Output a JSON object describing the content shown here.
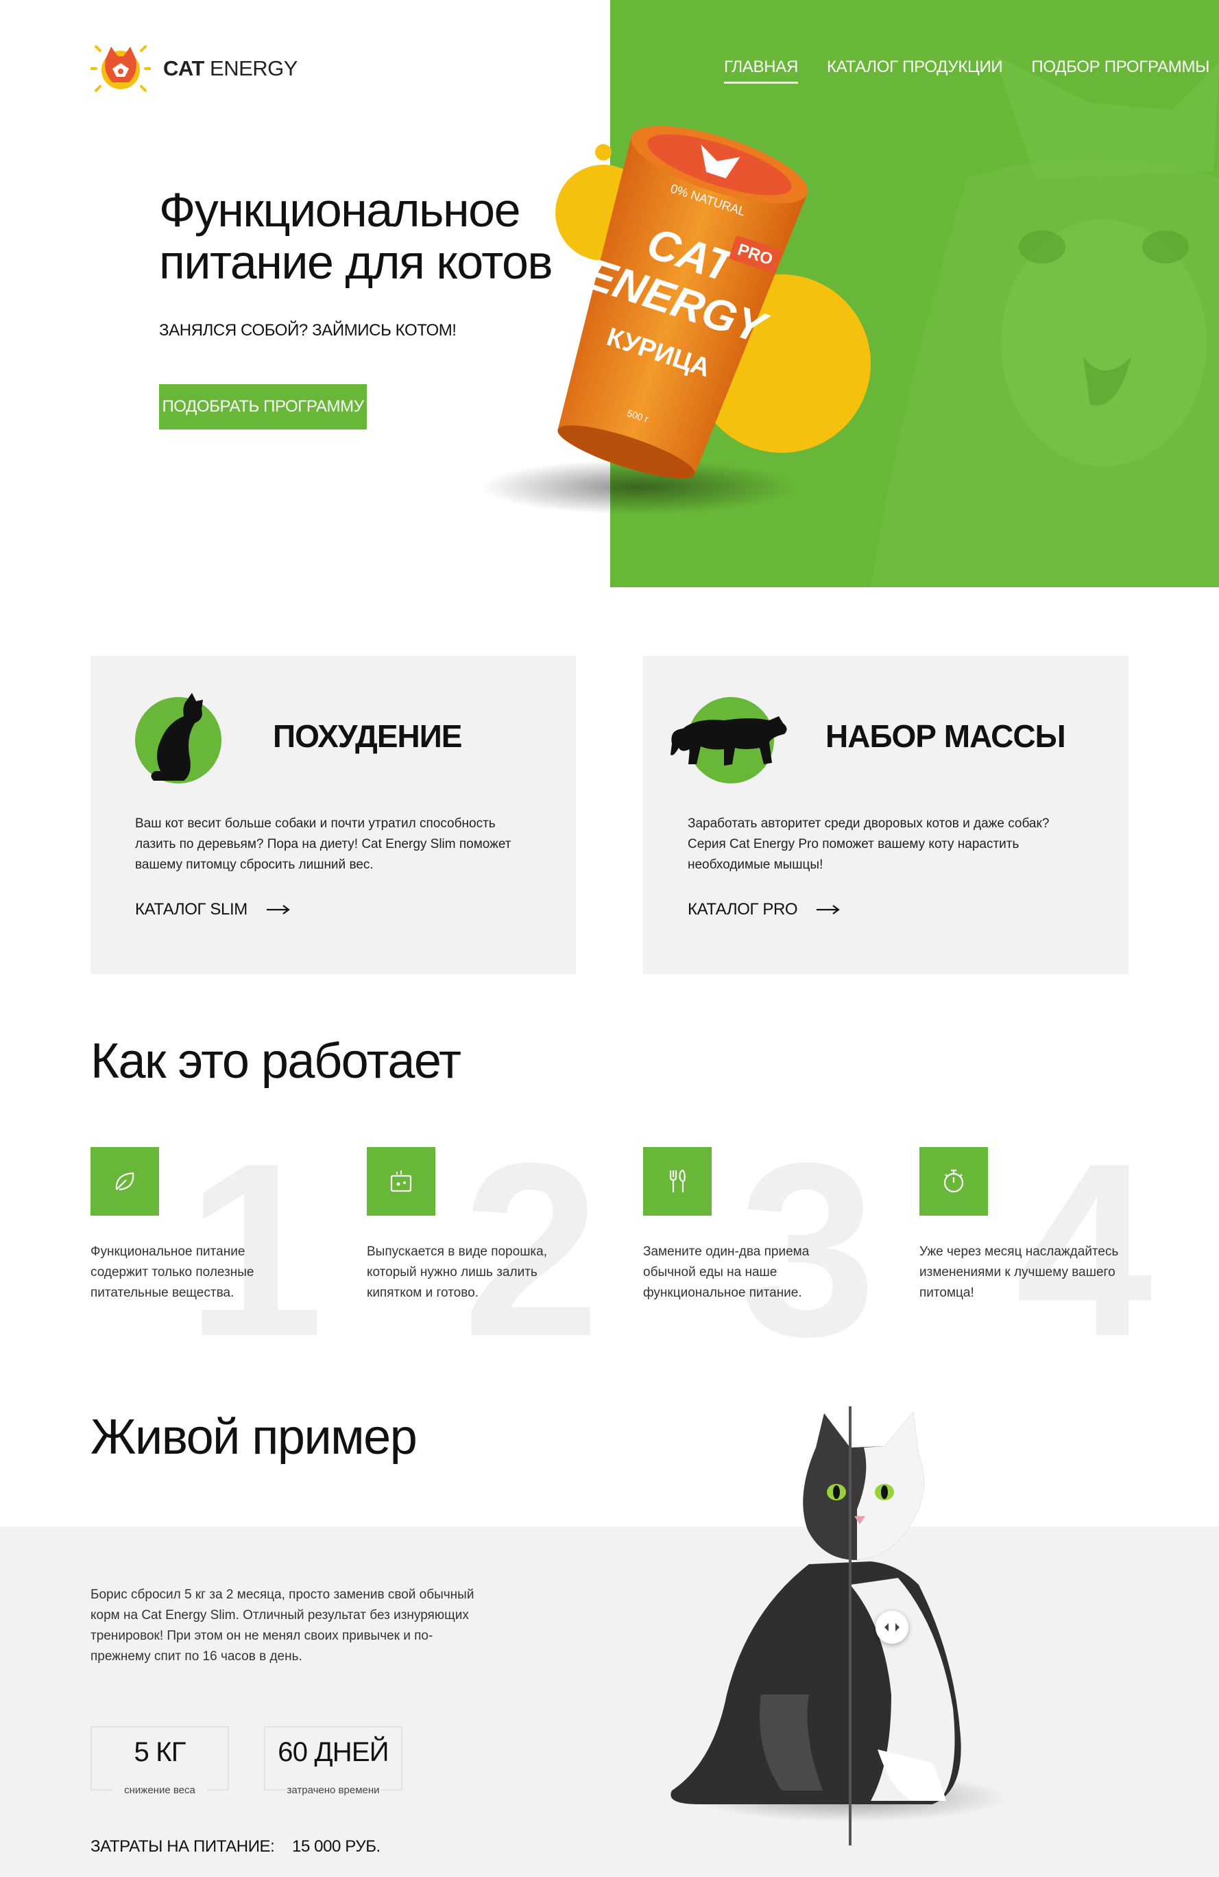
{
  "colors": {
    "accent": "#68b738",
    "yellow": "#f6c10e",
    "orange": "#f08a21",
    "card_bg": "#f2f2f2"
  },
  "header": {
    "logo": {
      "bold": "CAT",
      "regular": "ENERGY"
    },
    "nav": [
      {
        "label": "ГЛАВНАЯ",
        "active": true
      },
      {
        "label": "КАТАЛОГ ПРОДУКЦИИ",
        "active": false
      },
      {
        "label": "ПОДБОР ПРОГРАММЫ",
        "active": false
      }
    ]
  },
  "hero": {
    "title": "Функциональное питание для котов",
    "subtitle": "ЗАНЯЛСЯ СОБОЙ? ЗАЙМИСЬ КОТОМ!",
    "button": "ПОДОБРАТЬ ПРОГРАММУ",
    "product": {
      "brand_line1": "CAT",
      "brand_line2": "ENERGY",
      "badge": "PRO",
      "natural": "0% NATURAL",
      "flavor": "КУРИЦА",
      "weight": "500 г"
    }
  },
  "programs": [
    {
      "title": "ПОХУДЕНИЕ",
      "icon": "sitting-cat-icon",
      "text": "Ваш кот весит больше собаки и почти утратил способность лазить по деревьям? Пора на диету! Cat Energy Slim поможет вашему питомцу сбросить лишний вес.",
      "link": "КАТАЛОГ SLIM"
    },
    {
      "title": "НАБОР МАССЫ",
      "icon": "panther-icon",
      "text": "Заработать авторитет среди дворовых котов и даже собак? Серия Cat Energy Pro поможет вашему коту нарастить необходимые мышцы!",
      "link": "КАТАЛОГ PRO"
    }
  ],
  "how": {
    "title": "Как это работает",
    "steps": [
      {
        "num": "1",
        "icon": "leaf-icon",
        "text": "Функциональное питание содержит только полезные питательные вещества."
      },
      {
        "num": "2",
        "icon": "kettle-icon",
        "text": "Выпускается в виде порошка, который нужно лишь залить кипятком и готово."
      },
      {
        "num": "3",
        "icon": "fork-spoon-icon",
        "text": "Замените один-два приема обычной еды на наше функциональное питание."
      },
      {
        "num": "4",
        "icon": "stopwatch-icon",
        "text": "Уже через месяц наслаждайтесь изменениями к лучшему вашего питомца!"
      }
    ]
  },
  "example": {
    "title": "Живой пример",
    "text": "Борис сбросил 5 кг за 2 месяца, просто заменив свой обычный корм на Cat Energy Slim. Отличный результат без изнуряющих тренировок! При этом он не менял своих привычек и по-прежнему спит по 16 часов в день.",
    "stats": [
      {
        "value": "5 КГ",
        "label": "снижение веса"
      },
      {
        "value": "60 ДНЕЙ",
        "label": "затрачено времени"
      }
    ],
    "cost_label": "ЗАТРАТЫ НА ПИТАНИЕ:",
    "cost_value": "15 000 РУБ.",
    "slider": {
      "position": 0.5
    }
  }
}
